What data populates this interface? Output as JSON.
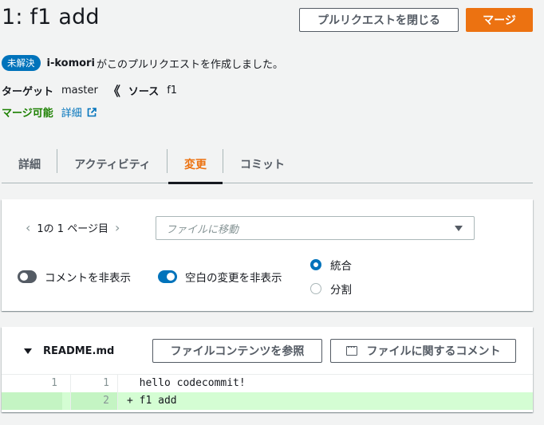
{
  "header": {
    "title": "1: f1 add",
    "close_pr_label": "プルリクエストを閉じる",
    "merge_label": "マージ"
  },
  "info": {
    "badge": "未解決",
    "author": "i-komori",
    "created_text": "がこのプルリクエストを作成しました。"
  },
  "branches": {
    "target_label": "ターゲット",
    "target_value": "master",
    "arrow": "《",
    "source_label": "ソース",
    "source_value": "f1"
  },
  "merge_status": {
    "status": "マージ可能",
    "details_link": "詳細"
  },
  "tabs": [
    {
      "label": "詳細",
      "active": false
    },
    {
      "label": "アクティビティ",
      "active": false
    },
    {
      "label": "変更",
      "active": true
    },
    {
      "label": "コミット",
      "active": false
    }
  ],
  "filters": {
    "pager_text": "1の 1 ページ目",
    "file_select_placeholder": "ファイルに移動",
    "hide_comments_label": "コメントを非表示",
    "hide_comments_on": false,
    "hide_whitespace_label": "空白の変更を非表示",
    "hide_whitespace_on": true,
    "view_modes": [
      {
        "label": "統合",
        "checked": true
      },
      {
        "label": "分割",
        "checked": false
      }
    ]
  },
  "diff": {
    "file_name": "README.md",
    "browse_button": "ファイルコンテンツを参照",
    "comment_button": "ファイルに関するコメント",
    "lines": [
      {
        "old": "1",
        "new": "1",
        "prefix": " ",
        "text": "hello codecommit!"
      },
      {
        "old": "",
        "new": "2",
        "prefix": "+",
        "text": "f1 add"
      }
    ]
  },
  "colors": {
    "primary": "#ec7211",
    "link": "#0073bb",
    "success": "#1d8102",
    "added_line": "#d4fdd3"
  }
}
